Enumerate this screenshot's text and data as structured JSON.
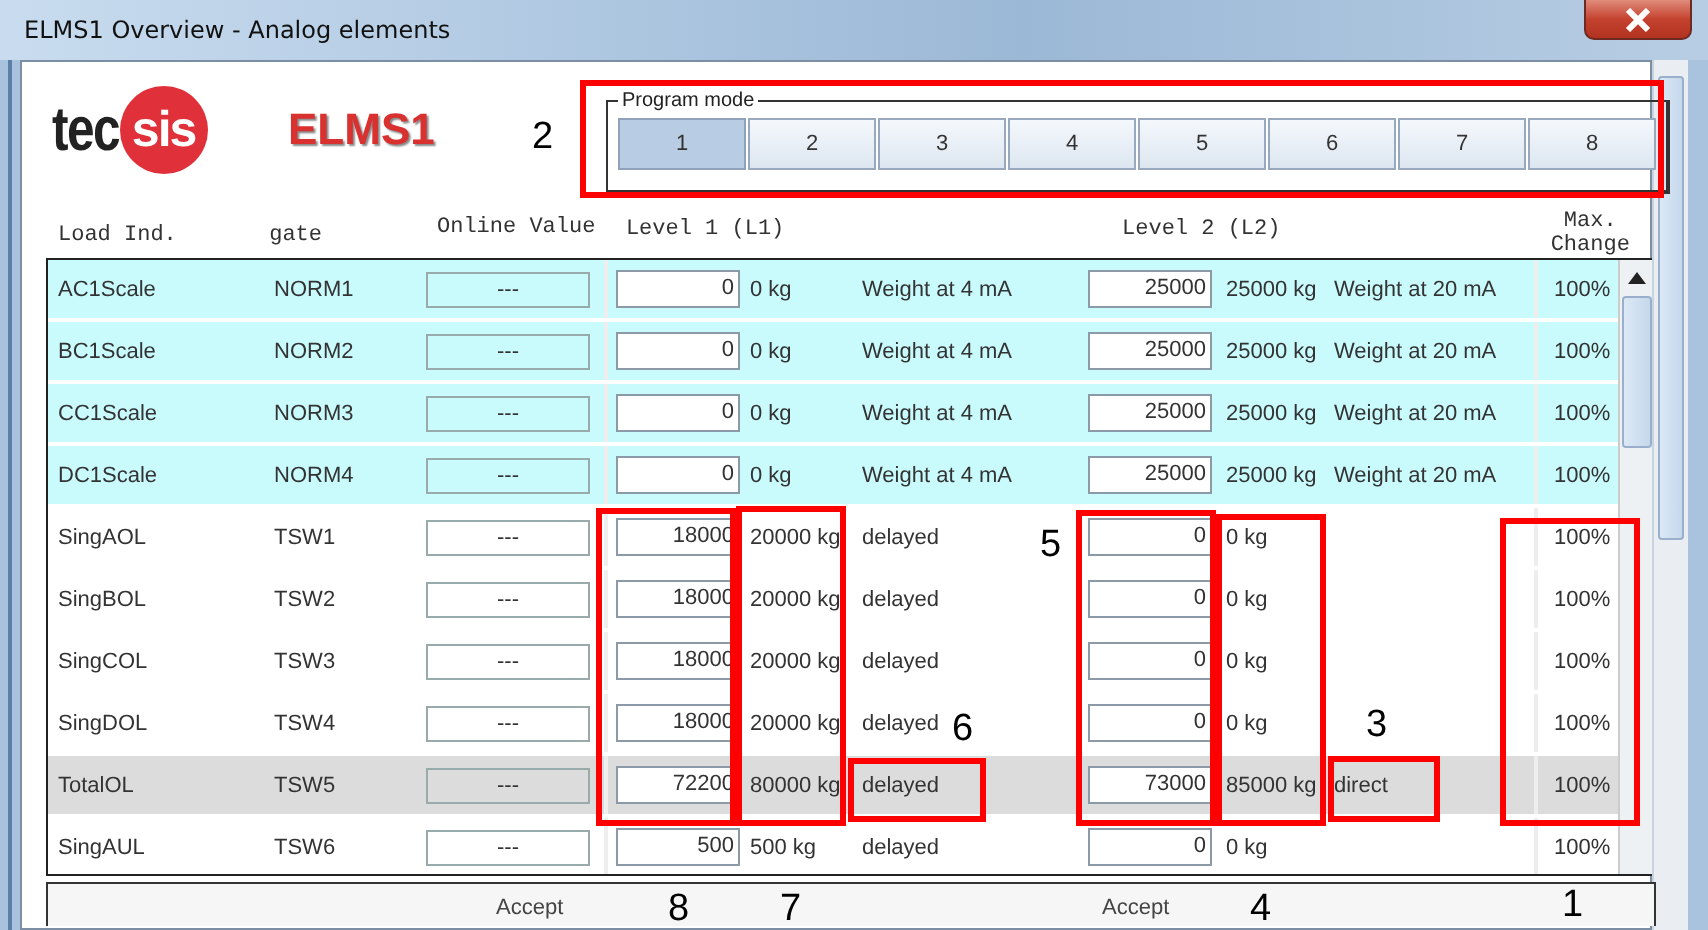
{
  "window": {
    "title": "ELMS1 Overview - Analog elements"
  },
  "logo": {
    "left": "tec",
    "right": "sis"
  },
  "product": "ELMS1",
  "program_mode": {
    "label": "Program mode",
    "buttons": [
      {
        "label": "1",
        "selected": true
      },
      {
        "label": "2",
        "selected": false
      },
      {
        "label": "3",
        "selected": false
      },
      {
        "label": "4",
        "selected": false
      },
      {
        "label": "5",
        "selected": false
      },
      {
        "label": "6",
        "selected": false
      },
      {
        "label": "7",
        "selected": false
      },
      {
        "label": "8",
        "selected": false
      }
    ]
  },
  "column_headers": [
    "Load Ind.",
    "gate",
    "Online Value",
    "Level 1 (L1)",
    "Level 2 (L2)",
    "Max. Change"
  ],
  "rows": [
    {
      "kind": "scale",
      "selected": false,
      "name": "AC1Scale",
      "gate": "NORM1",
      "online": "---",
      "l1_value": "0",
      "l1_reading": "0 kg",
      "l1_mode": "Weight at 4 mA",
      "l2_value": "25000",
      "l2_reading": "25000 kg",
      "l2_mode": "Weight at 20 mA",
      "max_change": "100%"
    },
    {
      "kind": "scale",
      "selected": false,
      "name": "BC1Scale",
      "gate": "NORM2",
      "online": "---",
      "l1_value": "0",
      "l1_reading": "0 kg",
      "l1_mode": "Weight at 4 mA",
      "l2_value": "25000",
      "l2_reading": "25000 kg",
      "l2_mode": "Weight at 20 mA",
      "max_change": "100%"
    },
    {
      "kind": "scale",
      "selected": false,
      "name": "CC1Scale",
      "gate": "NORM3",
      "online": "---",
      "l1_value": "0",
      "l1_reading": "0 kg",
      "l1_mode": "Weight at 4 mA",
      "l2_value": "25000",
      "l2_reading": "25000 kg",
      "l2_mode": "Weight at 20 mA",
      "max_change": "100%"
    },
    {
      "kind": "scale",
      "selected": false,
      "name": "DC1Scale",
      "gate": "NORM4",
      "online": "---",
      "l1_value": "0",
      "l1_reading": "0 kg",
      "l1_mode": "Weight at 4 mA",
      "l2_value": "25000",
      "l2_reading": "25000 kg",
      "l2_mode": "Weight at 20 mA",
      "max_change": "100%"
    },
    {
      "kind": "switch",
      "selected": false,
      "name": "SingAOL",
      "gate": "TSW1",
      "online": "---",
      "l1_value": "18000",
      "l1_reading": "20000 kg",
      "l1_mode": "delayed",
      "l2_value": "0",
      "l2_reading": "0 kg",
      "max_change": "100%"
    },
    {
      "kind": "switch",
      "selected": false,
      "name": "SingBOL",
      "gate": "TSW2",
      "online": "---",
      "l1_value": "18000",
      "l1_reading": "20000 kg",
      "l1_mode": "delayed",
      "l2_value": "0",
      "l2_reading": "0 kg",
      "max_change": "100%"
    },
    {
      "kind": "switch",
      "selected": false,
      "name": "SingCOL",
      "gate": "TSW3",
      "online": "---",
      "l1_value": "18000",
      "l1_reading": "20000 kg",
      "l1_mode": "delayed",
      "l2_value": "0",
      "l2_reading": "0 kg",
      "max_change": "100%"
    },
    {
      "kind": "switch",
      "selected": false,
      "name": "SingDOL",
      "gate": "TSW4",
      "online": "---",
      "l1_value": "18000",
      "l1_reading": "20000 kg",
      "l1_mode": "delayed",
      "l2_value": "0",
      "l2_reading": "0 kg",
      "max_change": "100%"
    },
    {
      "kind": "switch",
      "selected": true,
      "name": "TotalOL",
      "gate": "TSW5",
      "online": "---",
      "l1_value": "72200",
      "l1_reading": "80000 kg",
      "l1_mode": "delayed",
      "l2_value": "73000",
      "l2_reading": "85000 kg",
      "l2_mode": "direct",
      "max_change": "100%"
    },
    {
      "kind": "switch",
      "selected": false,
      "name": "SingAUL",
      "gate": "TSW6",
      "online": "---",
      "l1_value": "500",
      "l1_reading": "500 kg",
      "l1_mode": "delayed",
      "l2_value": "0",
      "l2_reading": "0 kg",
      "max_change": "100%"
    }
  ],
  "footer": {
    "buttons": [
      "Accept",
      "Accept"
    ]
  },
  "annotations": [
    {
      "label": "2"
    },
    {
      "label": "8"
    },
    {
      "label": "7"
    },
    {
      "label": "6"
    },
    {
      "label": "5"
    },
    {
      "label": "4"
    },
    {
      "label": "3"
    },
    {
      "label": "1"
    }
  ]
}
